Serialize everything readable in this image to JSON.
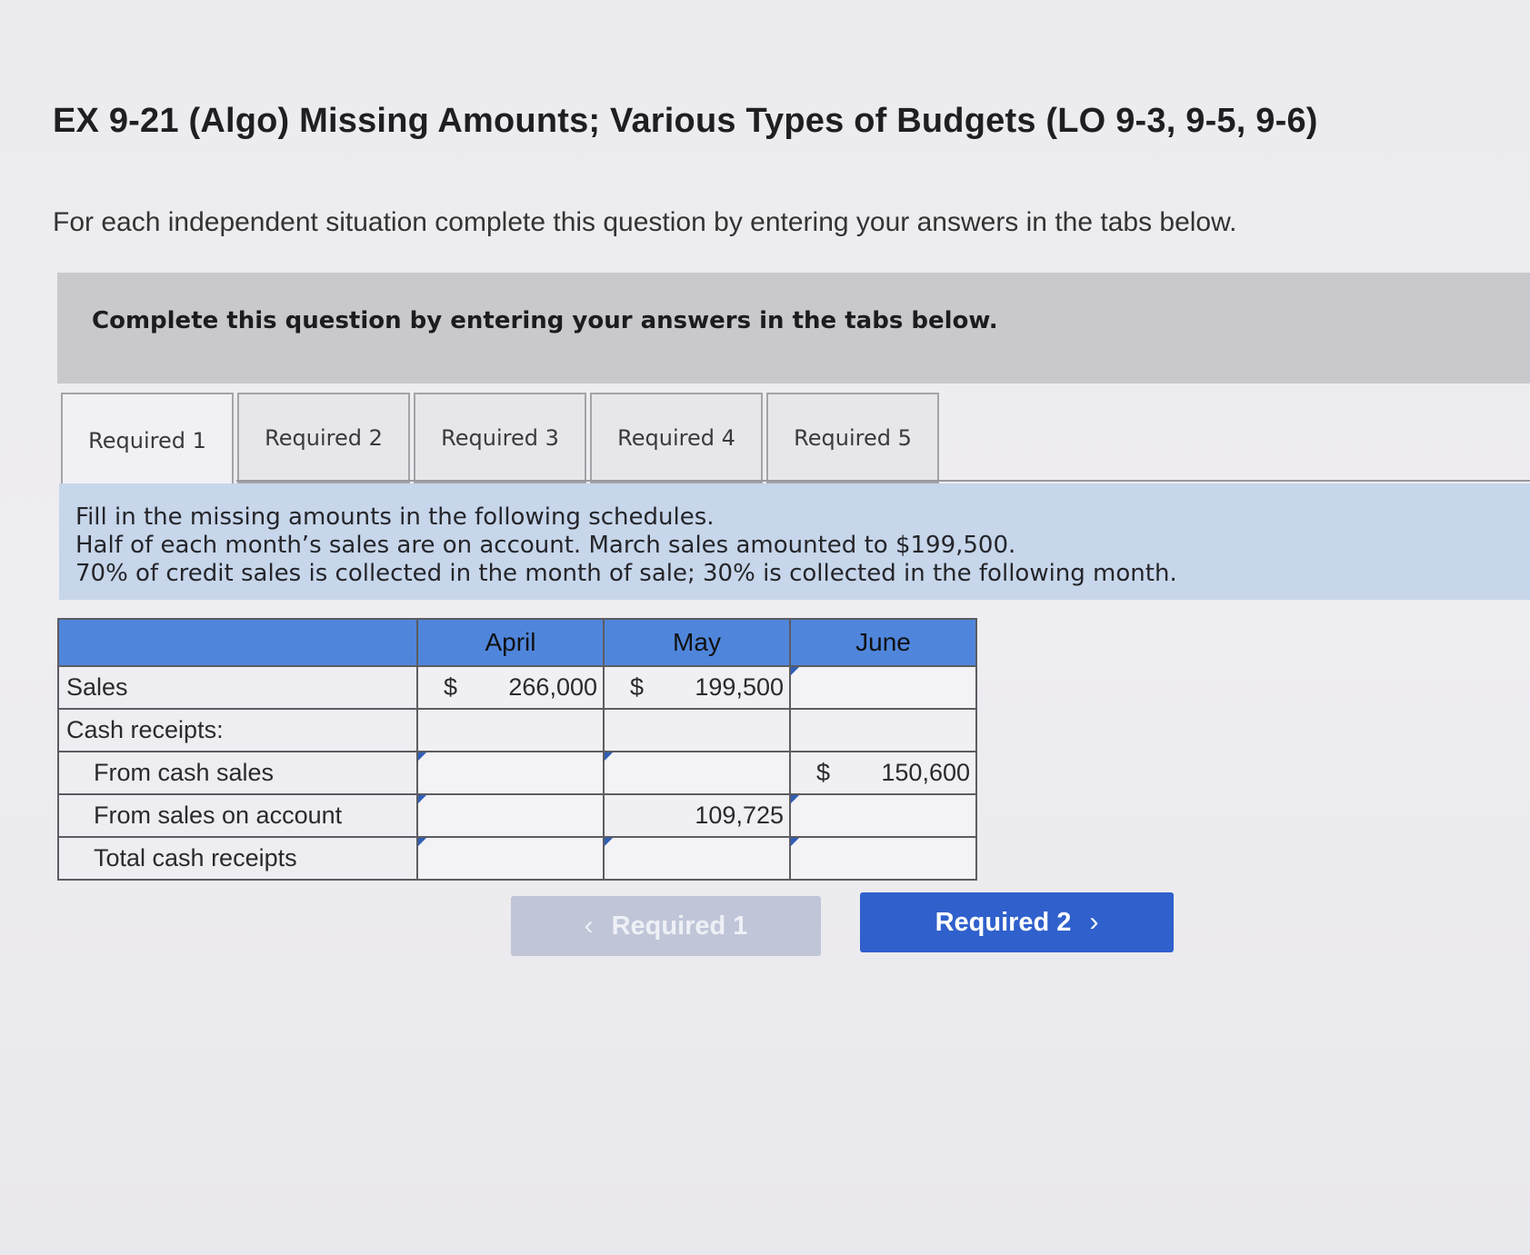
{
  "title": "EX 9-21 (Algo) Missing Amounts; Various Types of Budgets (LO 9-3, 9-5, 9-6)",
  "subtitle": "For each independent situation complete this question by entering your answers in the tabs below.",
  "banner": "Complete this question by entering your answers in the tabs below.",
  "tabs": [
    {
      "label": "Required 1",
      "active": true
    },
    {
      "label": "Required 2",
      "active": false
    },
    {
      "label": "Required 3",
      "active": false
    },
    {
      "label": "Required 4",
      "active": false
    },
    {
      "label": "Required 5",
      "active": false
    }
  ],
  "instructions": [
    "Fill in the missing amounts in the following schedules.",
    "Half of each month’s sales are on account. March sales amounted to $199,500.",
    "70% of credit sales is collected in the month of sale; 30% is collected in the following month."
  ],
  "table": {
    "columns": [
      "",
      "April",
      "May",
      "June"
    ],
    "currency": "$",
    "rows": {
      "sales": {
        "label": "Sales",
        "april": "266,000",
        "may": "199,500",
        "june": ""
      },
      "cash_receipts": {
        "label": "Cash receipts:"
      },
      "from_cash_sales": {
        "label": "From cash sales",
        "april": "",
        "may": "",
        "june": "150,600"
      },
      "from_sales_on_account": {
        "label": "From sales on account",
        "april": "",
        "may": "109,725",
        "june": ""
      },
      "total_cash_receipts": {
        "label": "Total cash receipts",
        "april": "",
        "may": "",
        "june": ""
      }
    }
  },
  "nav": {
    "prev_label": "Required 1",
    "next_label": "Required 2",
    "prev_icon": "‹",
    "next_icon": "›"
  }
}
